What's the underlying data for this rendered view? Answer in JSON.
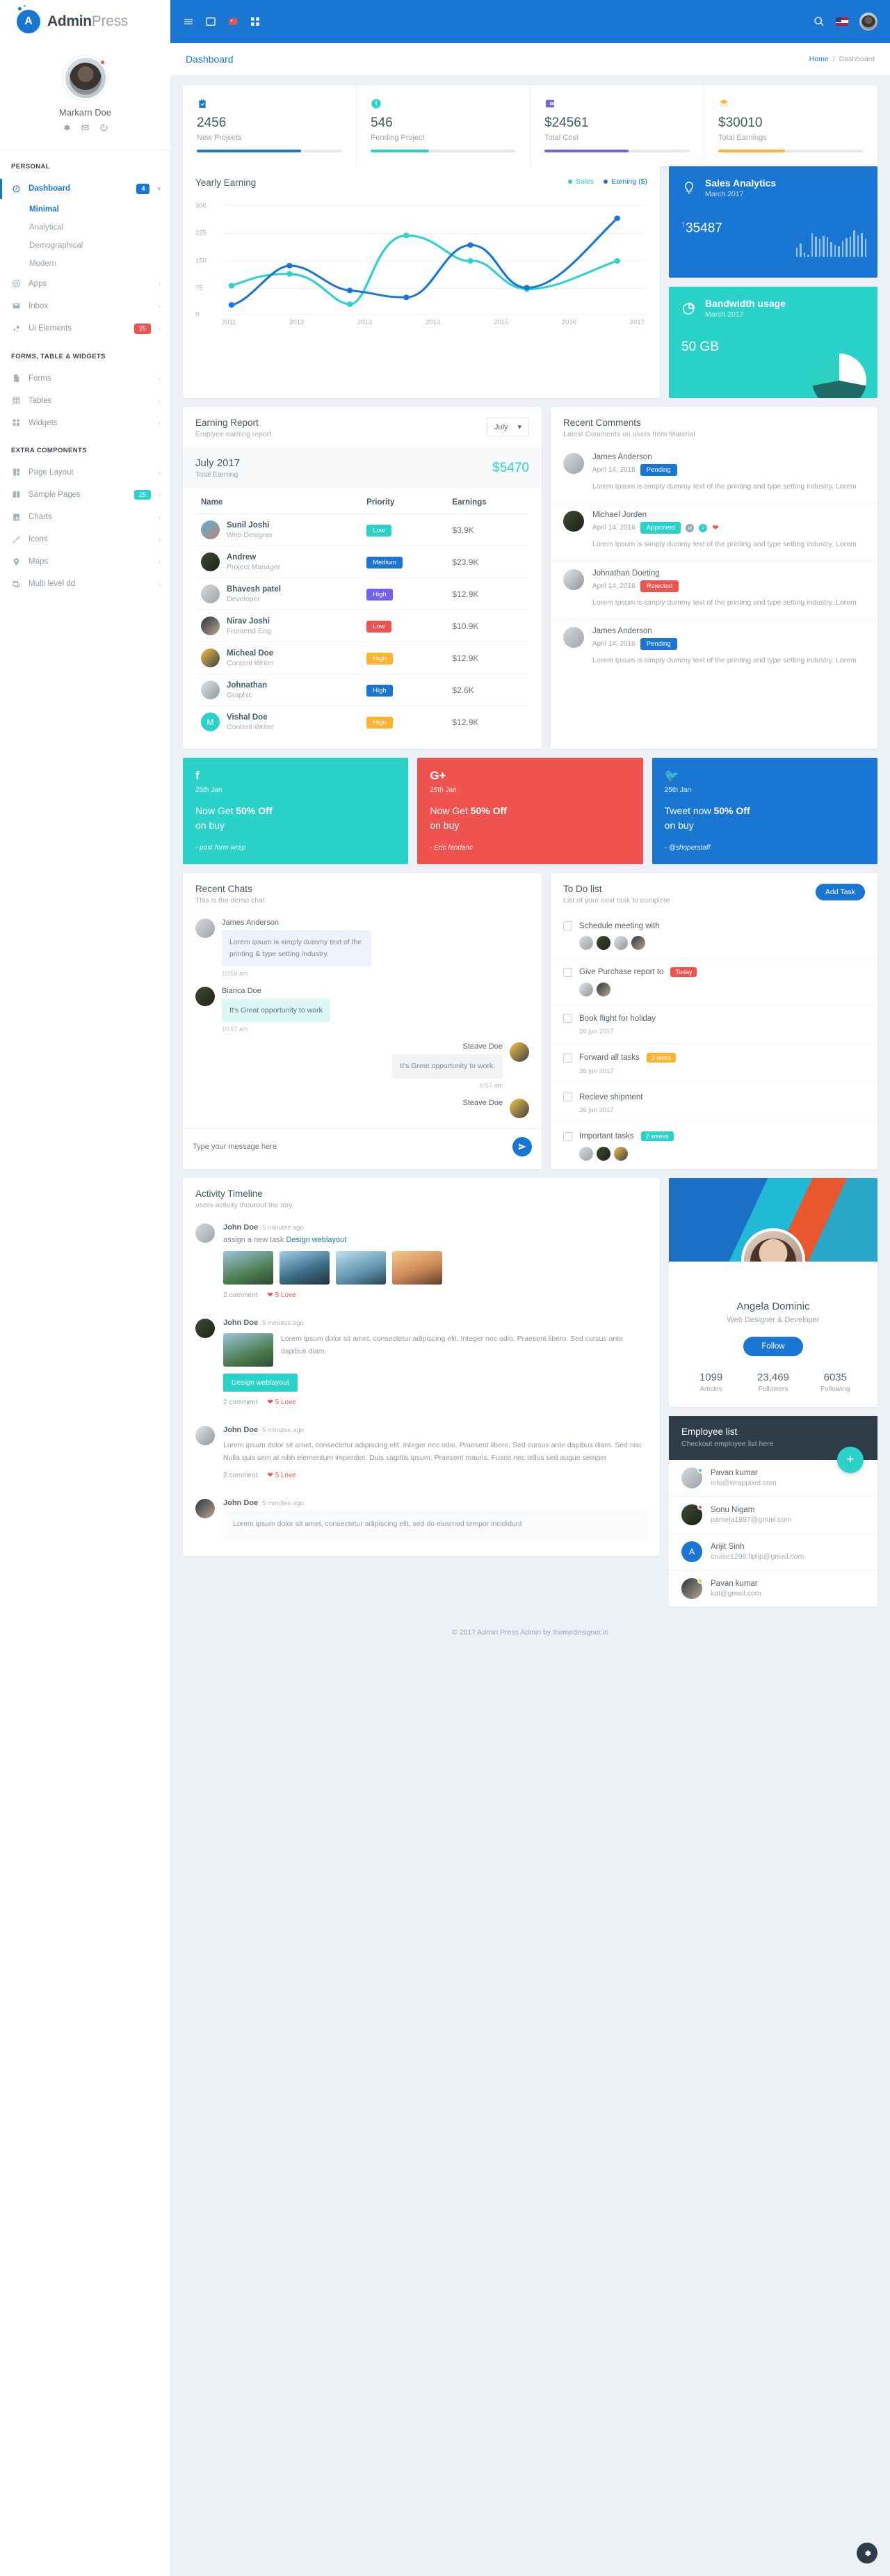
{
  "brand": {
    "bold": "Admin",
    "light": "Press"
  },
  "sidebar": {
    "profile": {
      "name": "Markarn Doe",
      "icons": [
        "gear-icon",
        "mail-icon",
        "power-icon"
      ]
    },
    "section_personal": "PERSONAL",
    "section_forms": "FORMS, TABLE & WIDGETS",
    "section_extra": "EXTRA COMPONENTS",
    "items": [
      {
        "label": "Dashboard",
        "icon": "speedometer-icon",
        "badge": "4",
        "badge_color": "#1976d2",
        "active": true
      },
      {
        "label": "Apps",
        "icon": "target-icon",
        "badge": "",
        "badge_color": ""
      },
      {
        "label": "Inbox",
        "icon": "mail-icon",
        "badge": "",
        "badge_color": ""
      },
      {
        "label": "Ui Elements",
        "icon": "bubbles-icon",
        "badge": "25",
        "badge_color": "#ef5350"
      },
      {
        "label": "Forms",
        "icon": "file-icon",
        "badge": "",
        "badge_color": ""
      },
      {
        "label": "Tables",
        "icon": "table-icon",
        "badge": "",
        "badge_color": ""
      },
      {
        "label": "Widgets",
        "icon": "widgets-icon",
        "badge": "",
        "badge_color": ""
      },
      {
        "label": "Page Layout",
        "icon": "layout-icon",
        "badge": "",
        "badge_color": ""
      },
      {
        "label": "Sample Pages",
        "icon": "book-icon",
        "badge": "25",
        "badge_color": "#2ad2c9"
      },
      {
        "label": "Charts",
        "icon": "bar-chart-icon",
        "badge": "",
        "badge_color": ""
      },
      {
        "label": "Icons",
        "icon": "brush-icon",
        "badge": "",
        "badge_color": ""
      },
      {
        "label": "Maps",
        "icon": "map-pin-icon",
        "badge": "",
        "badge_color": ""
      },
      {
        "label": "Multi level dd",
        "icon": "window-icon",
        "badge": "",
        "badge_color": ""
      }
    ],
    "dashboard_sub": [
      {
        "label": "Minimal",
        "active": true
      },
      {
        "label": "Analytical",
        "active": false
      },
      {
        "label": "Demographical",
        "active": false
      },
      {
        "label": "Modern",
        "active": false
      }
    ]
  },
  "header": {
    "title": "Dashboard",
    "breadcrumb_home": "Home",
    "breadcrumb_sep": "/",
    "breadcrumb_current": "Dashboard"
  },
  "stats": [
    {
      "value": "2456",
      "label": "New Projects",
      "color": "#1976d2",
      "pct": 72,
      "icon": "briefcase-check-icon"
    },
    {
      "value": "546",
      "label": "Pending Project",
      "color": "#2ad2c9",
      "pct": 40,
      "icon": "alert-circle-icon"
    },
    {
      "value": "$24561",
      "label": "Total Cost",
      "color": "#7460ee",
      "pct": 58,
      "icon": "wallet-icon"
    },
    {
      "value": "$30010",
      "label": "Total Earnings",
      "color": "#ffb22b",
      "pct": 46,
      "icon": "layers-icon"
    }
  ],
  "chart_data": {
    "type": "line",
    "title": "Yearly Earning",
    "xlabel": "",
    "ylabel": "",
    "x": [
      "2011",
      "2012",
      "2013",
      "2014",
      "2015",
      "2016",
      "2017"
    ],
    "yticks": [
      0,
      75,
      150,
      225,
      300
    ],
    "ylim": [
      0,
      300
    ],
    "grid": true,
    "legend_position": "top-right",
    "series": [
      {
        "name": "Sales",
        "color": "#2ad2c9",
        "values": [
          78,
          100,
          55,
          205,
          150,
          100,
          150
        ]
      },
      {
        "name": "Earning ($)",
        "color": "#1976d2",
        "values": [
          30,
          132,
          76,
          68,
          180,
          101,
          248
        ]
      }
    ]
  },
  "sales_analytics": {
    "title": "Sales Analytics",
    "subtitle": "March 2017",
    "value": "35487",
    "arrow": "↑",
    "color": "#1976d2",
    "spark": [
      22,
      32,
      10,
      6,
      58,
      50,
      44,
      52,
      48,
      36,
      30,
      26,
      40,
      46,
      50,
      66,
      54,
      58,
      44
    ]
  },
  "bandwidth": {
    "title": "Bandwidth usage",
    "subtitle": "March 2017",
    "value": "50 GB",
    "color": "#2ad2c9"
  },
  "earning_report": {
    "title": "Earning Report",
    "subtitle": "Emplyee earning report",
    "select_value": "July",
    "month": "July 2017",
    "total_label": "Total Earning",
    "total_value": "$5470",
    "columns": [
      "Name",
      "Priority",
      "Earnings"
    ],
    "rows": [
      {
        "name": "Sunil Joshi",
        "role": "Web Designer",
        "priority": "Low",
        "priority_color": "#2ad2c9",
        "earnings": "$3.9K",
        "avatar": "t1"
      },
      {
        "name": "Andrew",
        "role": "Project Manager",
        "priority": "Medium",
        "priority_color": "#1976d2",
        "earnings": "$23.9K",
        "avatar": "t2"
      },
      {
        "name": "Bhavesh patel",
        "role": "Developer",
        "priority": "High",
        "priority_color": "#7460ee",
        "earnings": "$12.9K",
        "avatar": "t3"
      },
      {
        "name": "Nirav Joshi",
        "role": "Frontend Eng",
        "priority": "Low",
        "priority_color": "#ef5350",
        "earnings": "$10.9K",
        "avatar": "t4"
      },
      {
        "name": "Micheal Doe",
        "role": "Content Writer",
        "priority": "High",
        "priority_color": "#ffb22b",
        "earnings": "$12.9K",
        "avatar": "t5"
      },
      {
        "name": "Johnathan",
        "role": "Graphic",
        "priority": "High",
        "priority_color": "#1976d2",
        "earnings": "$2.6K",
        "avatar": "t6"
      },
      {
        "name": "Vishal Doe",
        "role": "Content Writer",
        "priority": "High",
        "priority_color": "#ffb22b",
        "earnings": "$12.9K",
        "avatar": "letter",
        "initial": "M"
      }
    ]
  },
  "recent_comments": {
    "title": "Recent Comments",
    "subtitle": "Latest Comments on users from Material",
    "items": [
      {
        "name": "James Anderson",
        "date": "April 14, 2016",
        "status": "Pending",
        "status_color": "#1976d2",
        "text": "Lorem Ipsum is simply dummy text of the printing and type setting industry. Lorem",
        "actions": false,
        "avatar": "t3"
      },
      {
        "name": "Michael Jorden",
        "date": "April 14, 2016",
        "status": "Approved",
        "status_color": "#2ad2c9",
        "text": "Lorem Ipsum is simply dummy text of the printing and type setting industry. Lorem",
        "actions": true,
        "avatar": "t2"
      },
      {
        "name": "Johnathan Doeting",
        "date": "April 14, 2016",
        "status": "Rejected",
        "status_color": "#ef5350",
        "text": "Lorem Ipsum is simply dummy text of the printing and type setting industry. Lorem",
        "actions": false,
        "avatar": "t7"
      },
      {
        "name": "James Anderson",
        "date": "April 14, 2016",
        "status": "Pending",
        "status_color": "#1976d2",
        "text": "Lorem Ipsum is simply dummy text of the printing and type setting industry. Lorem",
        "actions": false,
        "avatar": "t3"
      }
    ]
  },
  "promos": [
    {
      "icon": "facebook-icon",
      "glyph": "f",
      "date": "25th Jan",
      "msg_pre": "Now Get ",
      "msg_bold": "50% Off",
      "msg_post": "on buy",
      "author": "- post form wrap",
      "color": "#2ad2c9"
    },
    {
      "icon": "google-plus-icon",
      "glyph": "G+",
      "date": "25th Jan",
      "msg_pre": "Now Get ",
      "msg_bold": "50% Off",
      "msg_post": "on buy",
      "author": "- Eric fandanc",
      "color": "#ef5350"
    },
    {
      "icon": "twitter-icon",
      "glyph": "t",
      "date": "25th Jan",
      "msg_pre": "Tweet now ",
      "msg_bold": "50% Off",
      "msg_post": "on buy",
      "author": "- @shoperstaff",
      "color": "#1976d2"
    }
  ],
  "chats": {
    "title": "Recent Chats",
    "subtitle": "This is the demo chat",
    "input_placeholder": "Type your message here",
    "messages": [
      {
        "name": "James Anderson",
        "text": "Lorem ipsum is simply dummy text of the printing & type setting industry.",
        "time": "10:56 am",
        "side": "left",
        "style": "blue",
        "avatar": "t3"
      },
      {
        "name": "Bianca Doe",
        "text": "It's Great opportunity to work",
        "time": "10:57 am",
        "side": "left",
        "style": "green",
        "avatar": "t2"
      },
      {
        "name": "Steave Doe",
        "text": "It's Great opportunity to work.",
        "time": "6:57 am",
        "side": "right",
        "style": "grey",
        "avatar": "t5"
      },
      {
        "name": "Steave Doe",
        "text": "",
        "time": "",
        "side": "right",
        "style": "grey",
        "avatar": "t5"
      }
    ]
  },
  "todo": {
    "title": "To Do list",
    "subtitle": "List of your next task to complete",
    "add_label": "Add Task",
    "items": [
      {
        "text": "Schedule meeting with",
        "badge": "",
        "badge_color": "",
        "date": "",
        "avatars": [
          "t3",
          "t2",
          "t7",
          "t4"
        ]
      },
      {
        "text": "Give Purchase report to",
        "badge": "Today",
        "badge_color": "#ef5350",
        "date": "",
        "avatars": [
          "t7",
          "t4"
        ]
      },
      {
        "text": "Book flight for holiday",
        "badge": "",
        "badge_color": "",
        "date": "26 jun 2017",
        "avatars": []
      },
      {
        "text": "Forward all tasks",
        "badge": "2 week",
        "badge_color": "#ffb22b",
        "date": "26 jun 2017",
        "avatars": []
      },
      {
        "text": "Recieve shipment",
        "badge": "",
        "badge_color": "",
        "date": "26 jun 2017",
        "avatars": []
      },
      {
        "text": "Important tasks",
        "badge": "2 weeks",
        "badge_color": "#2ad2c9",
        "date": "",
        "avatars": [
          "t3",
          "t2",
          "t5"
        ]
      }
    ]
  },
  "timeline": {
    "title": "Activity Timeline",
    "subtitle": "users activity thourout the day",
    "items": [
      {
        "name": "John Doe",
        "time": "5 minutes ago",
        "sub_pre": "assign a new task ",
        "sub_link": "Design weblayout",
        "thumbs": [
          "t-a",
          "t-b",
          "t-c",
          "t-d"
        ],
        "comment": "2 comment",
        "love": "5 Love",
        "para": "",
        "quote": "",
        "button": ""
      },
      {
        "name": "John Doe",
        "time": "5 minutes ago",
        "sub_pre": "",
        "sub_link": "",
        "thumbs": [],
        "comment": "2 comment",
        "love": "5 Love",
        "para": "Lorem ipsum dolor sit amet, consectetur adipiscing elit. Integer nec odio. Praesent libero. Sed cursus ante dapibus diam.",
        "quote": "",
        "button": "Design weblayout",
        "single_thumb": "t-a"
      },
      {
        "name": "John Doe",
        "time": "5 minutes ago",
        "sub_pre": "",
        "sub_link": "",
        "thumbs": [],
        "comment": "2 comment",
        "love": "5 Love",
        "para": "Lorem ipsum dolor sit amet, consectetur adipiscing elit. Integer nec odio. Praesent libero. Sed cursus ante dapibus diam. Sed nisi. Nulla quis sem at nibh elementum imperdiet. Duis sagittis ipsum. Praesent mauris. Fusce nec tellus sed augue semper",
        "quote": "",
        "button": ""
      },
      {
        "name": "John Doe",
        "time": "5 minutes ago",
        "sub_pre": "",
        "sub_link": "",
        "thumbs": [],
        "comment": "",
        "love": "",
        "para": "",
        "quote": "Lorem ipsum dolor sit amet, consectetur adipiscing elit, sed do eiusmod tempor incididunt",
        "button": ""
      }
    ]
  },
  "profile_card": {
    "name": "Angela Dominic",
    "role": "Web Designer & Developer",
    "follow_label": "Follow",
    "stats": [
      {
        "value": "1099",
        "label": "Articles"
      },
      {
        "value": "23,469",
        "label": "Followers"
      },
      {
        "value": "6035",
        "label": "Following"
      }
    ]
  },
  "employee_list": {
    "title": "Employee list",
    "subtitle": "Checkout employee list here",
    "add_icon": "plus-icon",
    "rows": [
      {
        "name": "Pavan kumar",
        "email": "info@wrappixel.com",
        "status_color": "#2ad2c9",
        "avatar": "t3",
        "initial": ""
      },
      {
        "name": "Sonu Nigam",
        "email": "pamela1987@gmail.com",
        "status_color": "#ef5350",
        "avatar": "t2",
        "initial": ""
      },
      {
        "name": "Arijit Sinh",
        "email": "cruise1298.fiplip@gmail.com",
        "status_color": "#ffb22b",
        "avatar": "blue",
        "initial": "A"
      },
      {
        "name": "Pavan kumar",
        "email": "kat@gmail.com",
        "status_color": "#ffb22b",
        "avatar": "t4",
        "initial": ""
      }
    ]
  },
  "footer": {
    "text": "© 2017 Admin Press Admin by themedesigner.in"
  }
}
